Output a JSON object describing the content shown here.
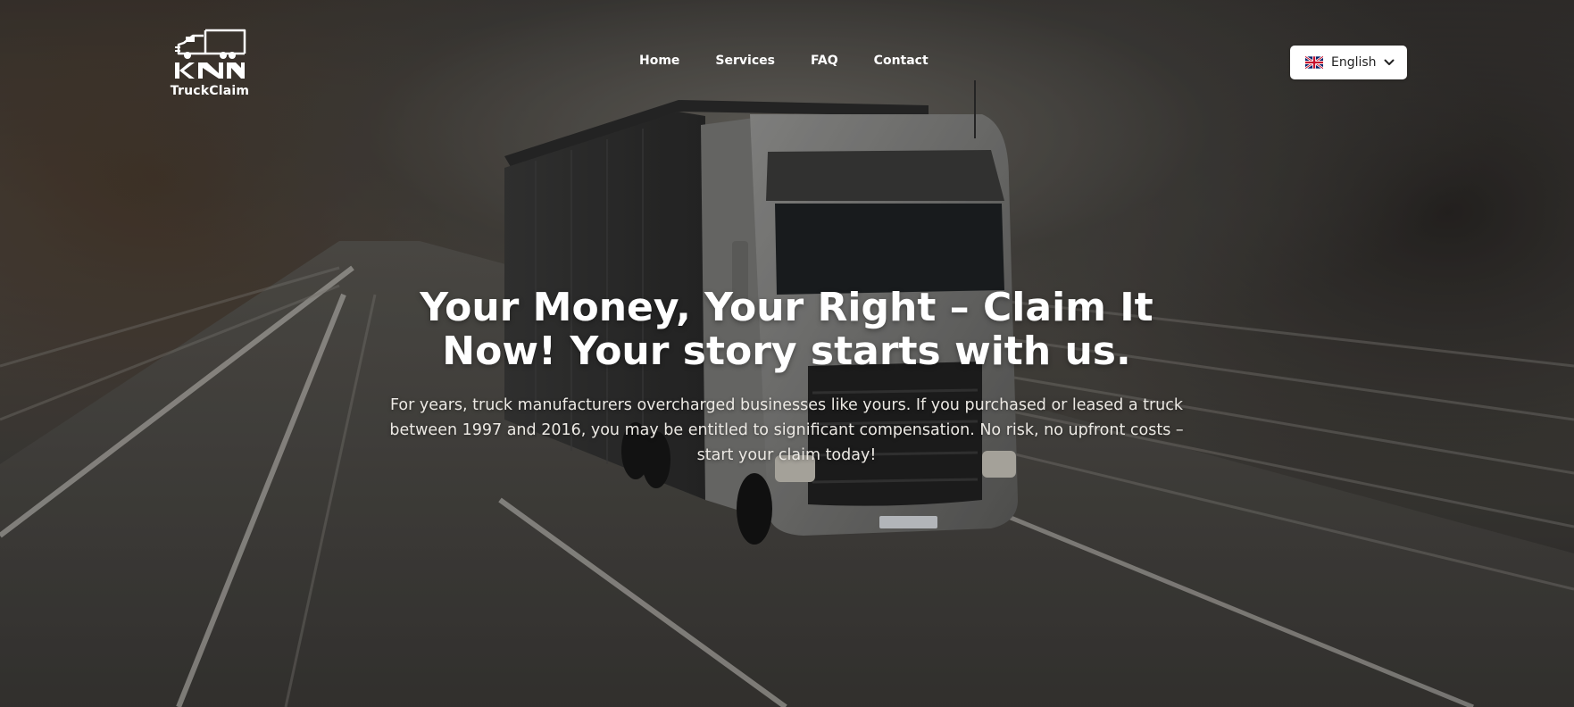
{
  "brand": {
    "logo_mark": "KNN",
    "name": "TruckClaim"
  },
  "nav": {
    "items": [
      {
        "label": "Home"
      },
      {
        "label": "Services"
      },
      {
        "label": "FAQ"
      },
      {
        "label": "Contact"
      }
    ]
  },
  "language": {
    "selected": "English",
    "flag_icon": "uk-flag-icon",
    "dropdown_icon": "chevron-down-icon"
  },
  "hero": {
    "headline": "Your Money, Your Right – Claim It Now! Your story starts with us.",
    "subtext": "For years, truck manufacturers overcharged businesses like yours. If you purchased or leased a truck between 1997 and 2016, you may be entitled to significant compensation. No risk, no upfront costs – start your claim today!"
  },
  "colors": {
    "text": "#ffffff",
    "button_bg": "#ffffff",
    "button_text": "#222222"
  }
}
